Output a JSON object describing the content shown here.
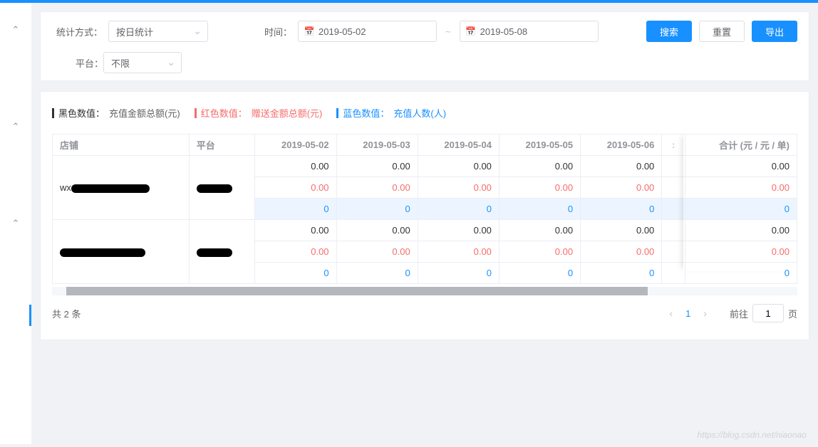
{
  "filters": {
    "stat_method_label": "统计方式：",
    "stat_method_value": "按日统计",
    "time_label": "时间：",
    "date_start": "2019-05-02",
    "date_separator": "~",
    "date_end": "2019-05-08",
    "platform_label": "平台：",
    "platform_value": "不限"
  },
  "buttons": {
    "search": "搜索",
    "reset": "重置",
    "export": "导出"
  },
  "legend": {
    "black_key": "黑色数值：",
    "black_val": "充值金额总额(元)",
    "red_key": "红色数值：",
    "red_val": "赠送金额总额(元)",
    "blue_key": "蓝色数值：",
    "blue_val": "充值人数(人)"
  },
  "table": {
    "headers": {
      "store": "店铺",
      "platform": "平台",
      "dates": [
        "2019-05-02",
        "2019-05-03",
        "2019-05-04",
        "2019-05-05",
        "2019-05-06"
      ],
      "total": "合计 (元 / 元 / 单)"
    },
    "rows": [
      {
        "store_prefix": "wx",
        "platform_redacted": true,
        "metrics": {
          "black": [
            "0.00",
            "0.00",
            "0.00",
            "0.00",
            "0.00",
            "0.00"
          ],
          "red": [
            "0.00",
            "0.00",
            "0.00",
            "0.00",
            "0.00",
            "0.00"
          ],
          "blue": [
            "0",
            "0",
            "0",
            "0",
            "0",
            "0"
          ]
        },
        "blue_highlight": true
      },
      {
        "store_prefix": "",
        "platform_redacted": true,
        "metrics": {
          "black": [
            "0.00",
            "0.00",
            "0.00",
            "0.00",
            "0.00",
            "0.00"
          ],
          "red": [
            "0.00",
            "0.00",
            "0.00",
            "0.00",
            "0.00",
            "0.00"
          ],
          "blue": [
            "0",
            "0",
            "0",
            "0",
            "0",
            "0"
          ]
        },
        "blue_highlight": false
      }
    ]
  },
  "pager": {
    "total_text": "共 2 条",
    "current": "1",
    "goto_label": "前往",
    "goto_value": "1",
    "goto_suffix": "页"
  },
  "watermark": "https://blog.csdn.net/niaonao"
}
